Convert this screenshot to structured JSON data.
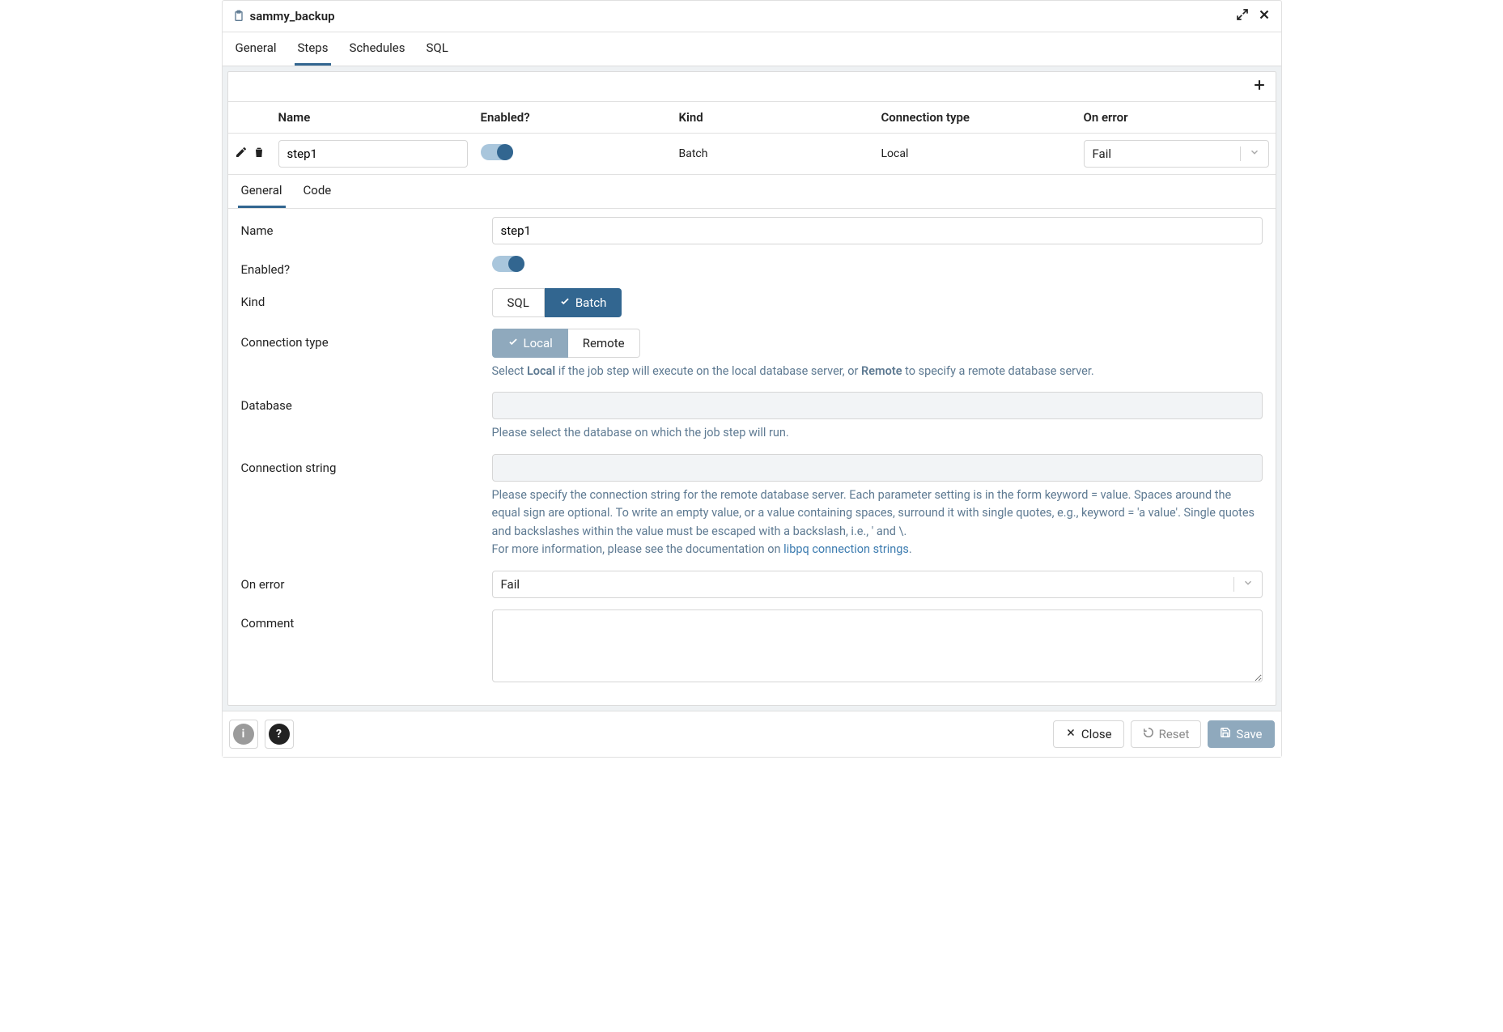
{
  "dialog": {
    "title": "sammy_backup"
  },
  "top_tabs": {
    "items": [
      "General",
      "Steps",
      "Schedules",
      "SQL"
    ],
    "active_index": 1
  },
  "grid": {
    "headers": {
      "name": "Name",
      "enabled": "Enabled?",
      "kind": "Kind",
      "connection_type": "Connection type",
      "on_error": "On error"
    },
    "rows": [
      {
        "name": "step1",
        "enabled": true,
        "kind": "Batch",
        "connection_type": "Local",
        "on_error": "Fail"
      }
    ]
  },
  "inner_tabs": {
    "items": [
      "General",
      "Code"
    ],
    "active_index": 0
  },
  "form": {
    "name": {
      "label": "Name",
      "value": "step1"
    },
    "enabled": {
      "label": "Enabled?",
      "value": true
    },
    "kind": {
      "label": "Kind",
      "options": [
        "SQL",
        "Batch"
      ],
      "selected": "Batch"
    },
    "connection_type": {
      "label": "Connection type",
      "options": [
        "Local",
        "Remote"
      ],
      "selected": "Local",
      "help_pre": "Select ",
      "help_b1": "Local",
      "help_mid": " if the job step will execute on the local database server, or ",
      "help_b2": "Remote",
      "help_post": " to specify a remote database server."
    },
    "database": {
      "label": "Database",
      "value": "",
      "help": "Please select the database on which the job step will run."
    },
    "connection_string": {
      "label": "Connection string",
      "value": "",
      "help_main": "Please specify the connection string for the remote database server. Each parameter setting is in the form keyword = value. Spaces around the equal sign are optional. To write an empty value, or a value containing spaces, surround it with single quotes, e.g., keyword = 'a value'. Single quotes and backslashes within the value must be escaped with a backslash, i.e., ' and \\.",
      "help_more_pre": "For more information, please see the documentation on ",
      "help_more_link": "libpq connection strings",
      "help_more_post": "."
    },
    "on_error": {
      "label": "On error",
      "value": "Fail"
    },
    "comment": {
      "label": "Comment",
      "value": ""
    }
  },
  "footer": {
    "close": "Close",
    "reset": "Reset",
    "save": "Save"
  }
}
